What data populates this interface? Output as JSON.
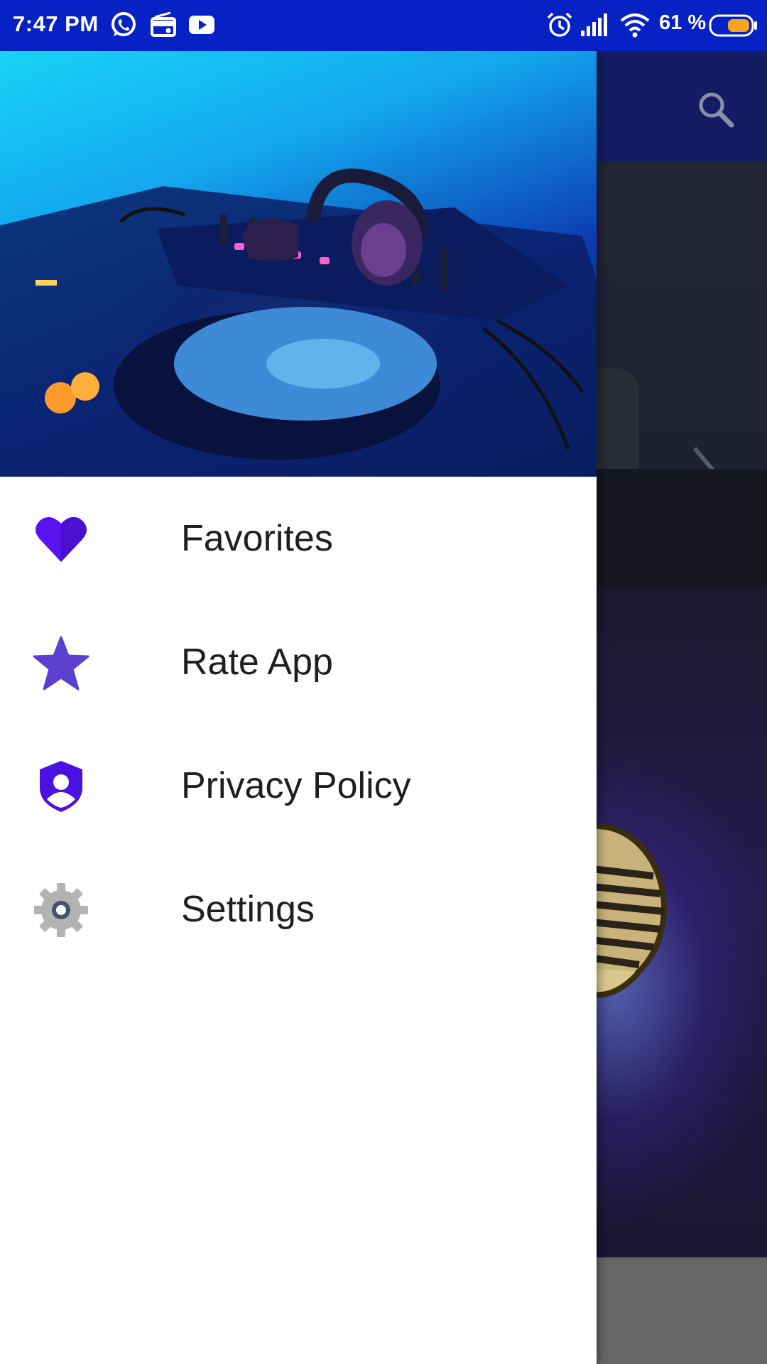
{
  "status_bar": {
    "time": "7:47 PM",
    "battery_percent": "61 %",
    "icons": [
      "whatsapp-icon",
      "radio-icon",
      "youtube-icon",
      "alarm-icon",
      "signal-icon",
      "wifi-icon",
      "battery-icon"
    ],
    "background_color": "#0621c4"
  },
  "drawer": {
    "header_image": "dj-turntable-headphones",
    "items": [
      {
        "label": "Favorites",
        "icon": "heart-icon",
        "color": "#5a12f0"
      },
      {
        "label": "Rate App",
        "icon": "star-icon",
        "color": "#5a3fd0"
      },
      {
        "label": "Privacy Policy",
        "icon": "shield-person-icon",
        "color": "#4a12e0"
      },
      {
        "label": "Settings",
        "icon": "gear-icon",
        "color": "#b0b0b0"
      }
    ]
  },
  "background_app": {
    "toolbar_color": "#141d63",
    "icons": [
      "search-icon",
      "chevron-right-icon",
      "microphone-image"
    ]
  }
}
